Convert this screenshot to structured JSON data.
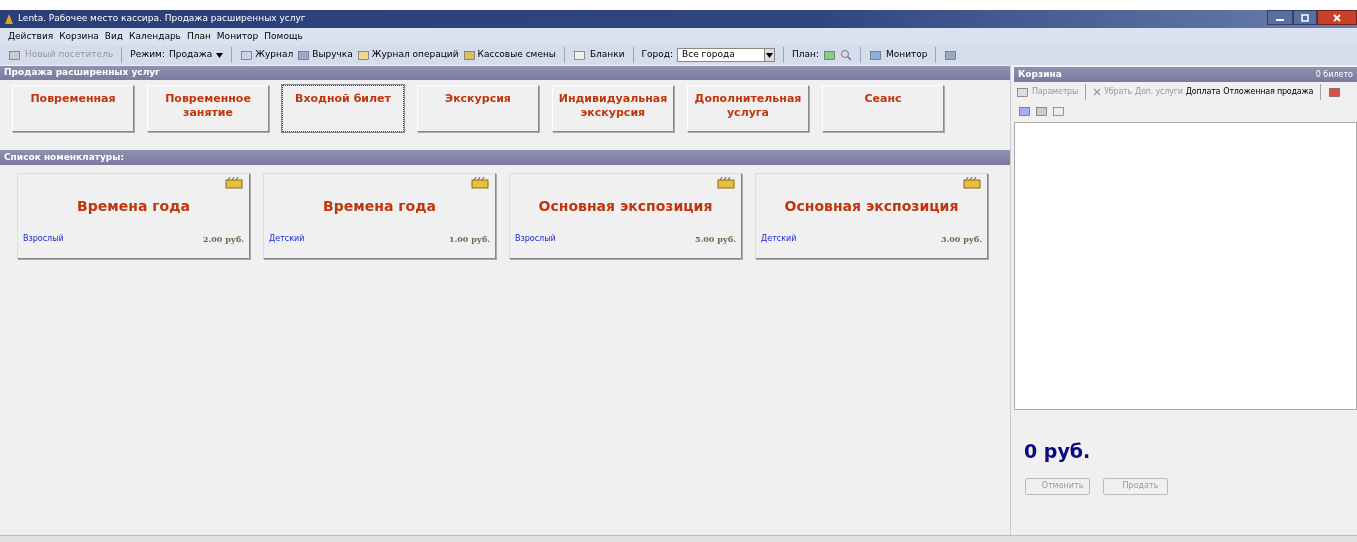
{
  "window": {
    "title": "Lenta. Рабочее место кассира. Продажа расширенных услуг"
  },
  "menu": [
    "Действия",
    "Корзина",
    "Вид",
    "Календарь",
    "План",
    "Монитор",
    "Помощь"
  ],
  "toolbar": {
    "new_visitor": {
      "label": "Новый посетитель",
      "disabled": true
    },
    "mode_label": "Режим:",
    "mode_value": "Продажа",
    "items": [
      "Журнал",
      "Выручка",
      "Журнал операций",
      "Кассовые смены"
    ],
    "forms": "Бланки",
    "city_label": "Город:",
    "city_value": "Все города",
    "plan_label": "План:",
    "monitor": "Монитор"
  },
  "services": {
    "title": "Продажа расширенных услуг",
    "buttons": [
      {
        "label": "Повременная",
        "selected": false
      },
      {
        "label": "Повременное занятие",
        "selected": false
      },
      {
        "label": "Входной билет",
        "selected": true
      },
      {
        "label": "Экскурсия",
        "selected": false
      },
      {
        "label": "Индивидуальная экскурсия",
        "selected": false
      },
      {
        "label": "Дополнительная услуга",
        "selected": false
      },
      {
        "label": "Сеанс",
        "selected": false
      }
    ]
  },
  "nomenclature": {
    "title": "Список номенклатуры:",
    "cards": [
      {
        "name": "Времена года",
        "category": "Взрослый",
        "price": "2.00 руб."
      },
      {
        "name": "Времена года",
        "category": "Детский",
        "price": "1.00 руб."
      },
      {
        "name": "Основная экспозиция",
        "category": "Взрослый",
        "price": "5.00 руб."
      },
      {
        "name": "Основная экспозиция",
        "category": "Детский",
        "price": "3.00 руб."
      }
    ]
  },
  "cart": {
    "title": "Корзина",
    "count": "0 билето",
    "actions": [
      {
        "label": "Параметры",
        "disabled": true
      },
      {
        "label": "Убрать",
        "disabled": true
      },
      {
        "label": "Доп. услуги",
        "disabled": true
      },
      {
        "label": "Доплата",
        "disabled": false
      },
      {
        "label": "Отложенная продажа",
        "disabled": false
      }
    ],
    "total": "0 руб.",
    "buttons": [
      {
        "label": "Отменить",
        "disabled": true
      },
      {
        "label": "Продать",
        "disabled": true
      }
    ]
  }
}
